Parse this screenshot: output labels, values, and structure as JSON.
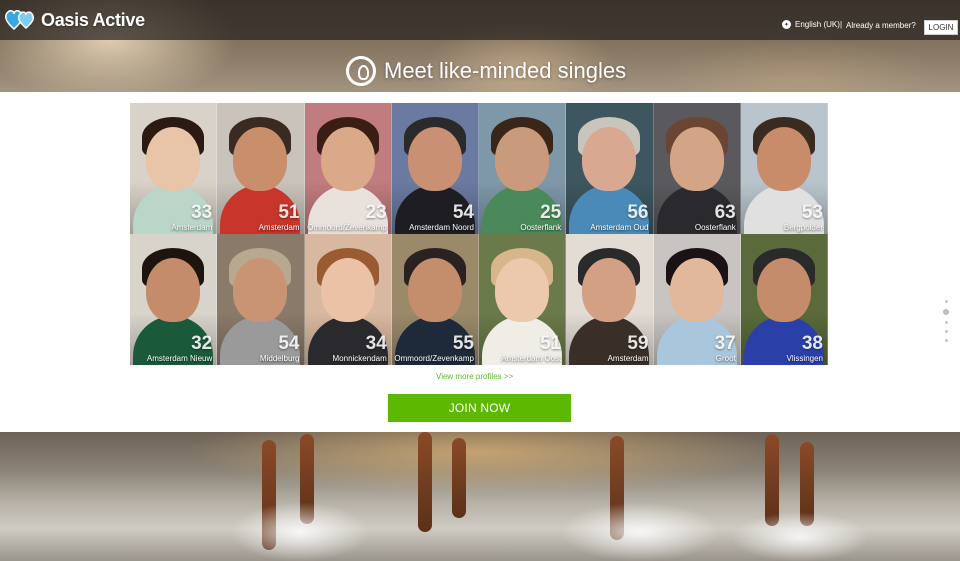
{
  "header": {
    "logo_text": "Oasis Active",
    "language_label": "English (UK)",
    "language_icon": "globe-icon",
    "separator": "|",
    "already_member": "Already a member?",
    "login_label": "LOGIN"
  },
  "hero": {
    "headline": "Meet like-minded singles",
    "icon": "profile-pin-icon"
  },
  "profiles": [
    {
      "age": "33",
      "city": "Amsterdam",
      "bg": "#d9d2c8",
      "skin": "#e8c4a8",
      "hair": "#2a1a12",
      "shirt": "#b9d6c8"
    },
    {
      "age": "51",
      "city": "Amsterdam",
      "bg": "#c9c3bc",
      "skin": "#c98e6a",
      "hair": "#3a2a22",
      "shirt": "#c8352a"
    },
    {
      "age": "23",
      "city": "Ommoord/Zevenkamp",
      "bg": "#c07c7e",
      "skin": "#d9a98a",
      "hair": "#3a1e14",
      "shirt": "#e9e2dc"
    },
    {
      "age": "54",
      "city": "Amsterdam Noord",
      "bg": "#6a7aa0",
      "skin": "#c99074",
      "hair": "#2a2a2a",
      "shirt": "#1e1e22"
    },
    {
      "age": "25",
      "city": "Oosterflank",
      "bg": "#7f98a8",
      "skin": "#c99a7c",
      "hair": "#3a2618",
      "shirt": "#4a8a5a"
    },
    {
      "age": "56",
      "city": "Amsterdam Oud",
      "bg": "#3e5660",
      "skin": "#d8a890",
      "hair": "#c9c4bc",
      "shirt": "#4a8ab8"
    },
    {
      "age": "63",
      "city": "Oosterflank",
      "bg": "#5a5a5e",
      "skin": "#d4a486",
      "hair": "#6a4632",
      "shirt": "#2a2a2e"
    },
    {
      "age": "53",
      "city": "Bergpolder",
      "bg": "#b9c4cc",
      "skin": "#c98c6a",
      "hair": "#3a2a20",
      "shirt": "#e0e0e0"
    },
    {
      "age": "32",
      "city": "Amsterdam Nieuw",
      "bg": "#d8d4cc",
      "skin": "#c48c6a",
      "hair": "#1e140e",
      "shirt": "#1a5a3a"
    },
    {
      "age": "54",
      "city": "Middelburg",
      "bg": "#8a7a6a",
      "skin": "#c99474",
      "hair": "#b8a890",
      "shirt": "#9a9a9a"
    },
    {
      "age": "34",
      "city": "Monnickendam",
      "bg": "#d8b8a0",
      "skin": "#ecc2a6",
      "hair": "#9a5a32",
      "shirt": "#2a2a2e"
    },
    {
      "age": "55",
      "city": "Ommoord/Zevenkamp",
      "bg": "#9a8a6a",
      "skin": "#c48e6c",
      "hair": "#2a2220",
      "shirt": "#1e2a3a"
    },
    {
      "age": "51",
      "city": "Amsterdam Oost",
      "bg": "#6a7a4a",
      "skin": "#ecc8ac",
      "hair": "#d6b68a",
      "shirt": "#f0ece6"
    },
    {
      "age": "59",
      "city": "Amsterdam",
      "bg": "#e2dcd4",
      "skin": "#d4a084",
      "hair": "#2a2a2a",
      "shirt": "#3a2e28"
    },
    {
      "age": "37",
      "city": "Groot",
      "bg": "#c8c4c2",
      "skin": "#e2b89c",
      "hair": "#1a1214",
      "shirt": "#a9c6dc"
    },
    {
      "age": "38",
      "city": "Vlissingen",
      "bg": "#5a6a3a",
      "skin": "#c48c6a",
      "hair": "#2a2a2a",
      "shirt": "#2a40a8"
    }
  ],
  "view_more": "View more profiles >>",
  "join_label": "JOIN NOW",
  "colors": {
    "accent_green": "#5cb800",
    "link_green": "#5cb82a"
  }
}
